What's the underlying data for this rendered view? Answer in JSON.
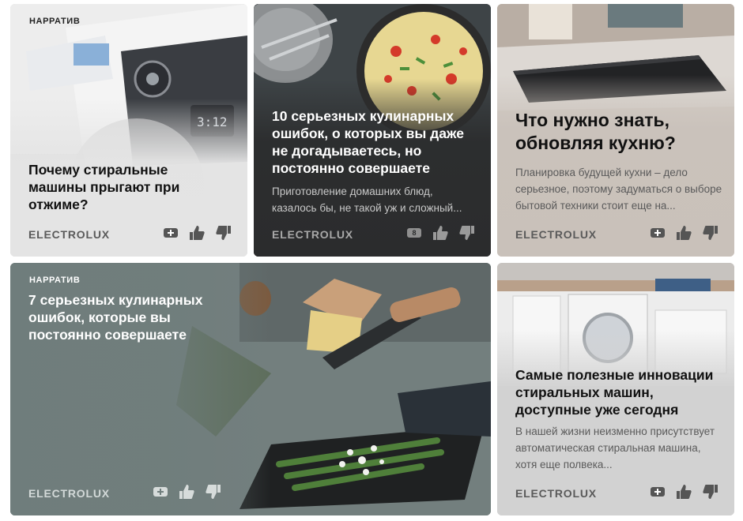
{
  "cards": [
    {
      "badge": "НАРРАТИВ",
      "title": "Почему стиральные машины прыгают при отжиме?",
      "source": "ELECTROLUX",
      "comment_count": ""
    },
    {
      "title": "10 серьезных кулинарных ошибок, о которых вы даже не догадываетесь, но постоянно совершаете",
      "description": "Приготовление домашних блюд, казалось бы, не такой уж и сложный...",
      "source": "ELECTROLUX",
      "comment_count": "8"
    },
    {
      "title": "Что нужно знать, обновляя кухню?",
      "description": "Планировка будущей кухни – дело серьезное, поэтому задуматься о выборе бытовой техники стоит еще на...",
      "source": "ELECTROLUX",
      "comment_count": ""
    },
    {
      "badge": "НАРРАТИВ",
      "title": "7 серьезных кулинарных ошибок, которые вы постоянно совершаете",
      "source": "ELECTROLUX",
      "comment_count": ""
    },
    {
      "title": "Самые полезные инновации стиральных машин, доступные уже сегодня",
      "description": "В нашей жизни неизменно присутствует автоматическая стиральная машина, хотя еще полвека...",
      "source": "ELECTROLUX",
      "comment_count": ""
    }
  ],
  "icons": {
    "comment": "comment-plus-icon",
    "like": "thumbs-up-icon",
    "dislike": "thumbs-down-icon"
  },
  "colors": {
    "light_card_text": "#111111",
    "dark_card_text": "#ffffff",
    "source_gray": "#5a5a5a"
  }
}
